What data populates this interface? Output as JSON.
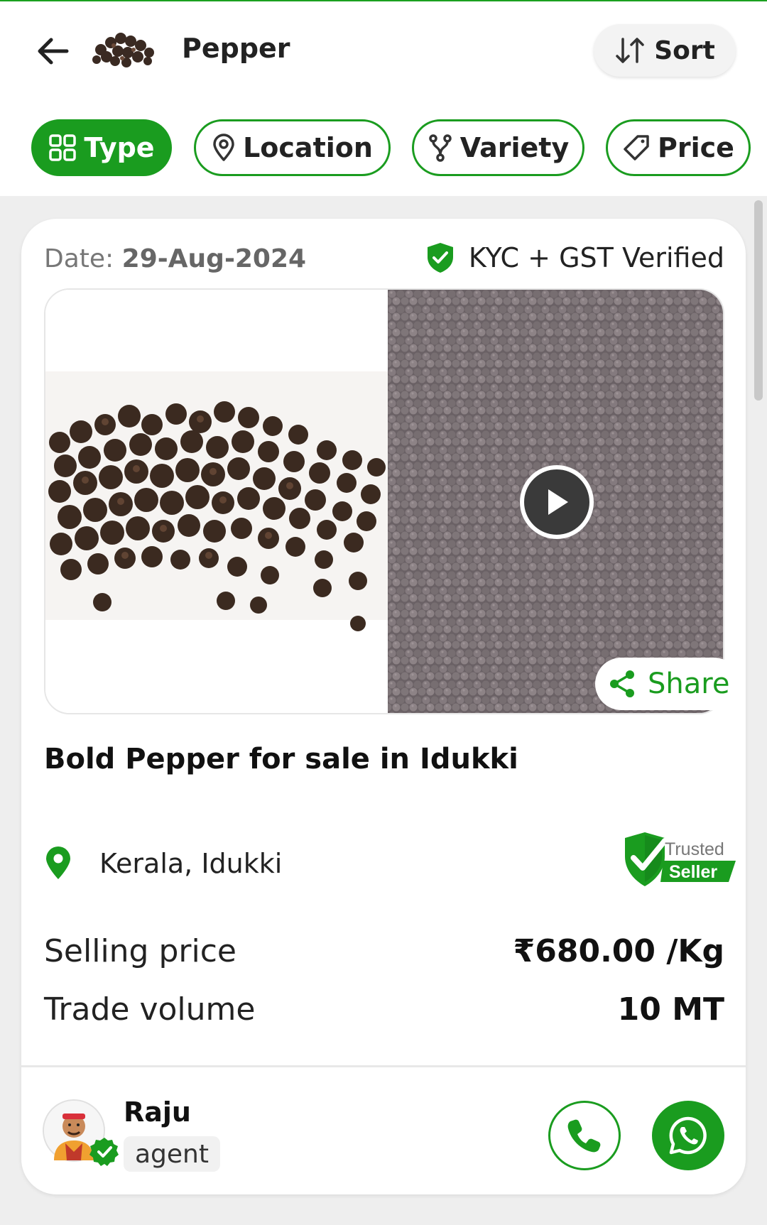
{
  "header": {
    "title": "Pepper",
    "sort_label": "Sort"
  },
  "filters": [
    {
      "label": "Type",
      "icon": "grid-icon",
      "active": true
    },
    {
      "label": "Location",
      "icon": "map-pin-icon",
      "active": false
    },
    {
      "label": "Variety",
      "icon": "branch-icon",
      "active": false
    },
    {
      "label": "Price",
      "icon": "tag-icon",
      "active": false
    }
  ],
  "listing": {
    "date_label": "Date:",
    "date_value": "29-Aug-2024",
    "verification": "KYC + GST Verified",
    "share_label": "Share",
    "title": "Bold Pepper for sale in Idukki",
    "location": "Kerala, Idukki",
    "badge_line1": "Trusted",
    "badge_line2": "Seller",
    "selling_price_label": "Selling price",
    "selling_price_value": "₹680.00 /Kg",
    "trade_volume_label": "Trade volume",
    "trade_volume_value": "10 MT"
  },
  "seller": {
    "name": "Raju",
    "role": "agent"
  },
  "colors": {
    "accent": "#1a9c1f",
    "background": "#eeeeee",
    "card": "#ffffff"
  }
}
